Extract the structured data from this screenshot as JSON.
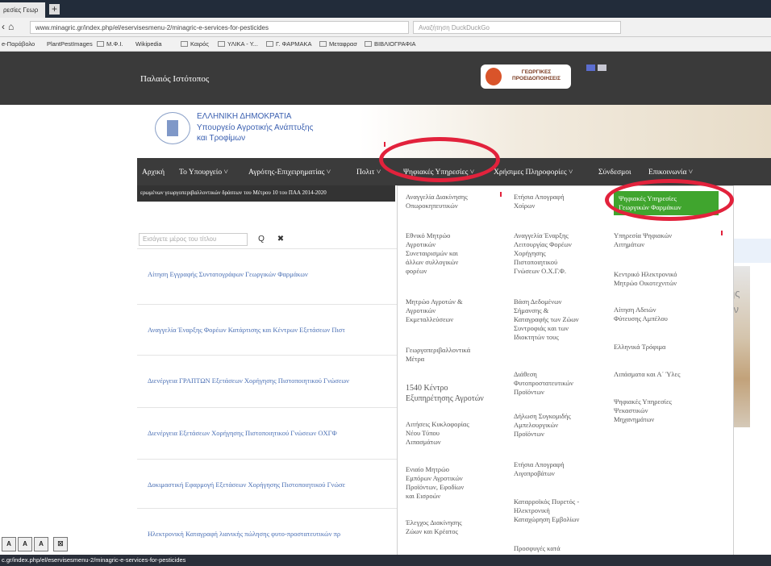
{
  "browser": {
    "tab_title": "ρεσίες Γεωρ",
    "new_tab": "+",
    "url": "www.minagric.gr/index.php/el/eservisesmenu-2/minagric-e-services-for-pesticides",
    "search_placeholder": "Αναζήτηση DuckDuckGo",
    "bookmarks": [
      {
        "label": "e-Παράβολο"
      },
      {
        "label": "PlantPestImages"
      },
      {
        "label": "M.Φ.Ι."
      },
      {
        "label": "Wikipedia"
      },
      {
        "label": "Καιρός"
      },
      {
        "label": "ΥΛΙΚΑ - Υ..."
      },
      {
        "label": "Γ. ΦΑΡΜΑΚΑ"
      },
      {
        "label": "Μεταφρασ"
      },
      {
        "label": "ΒΙΒΛΙΟΓΡΑΦΙΑ"
      }
    ]
  },
  "header": {
    "old_site": "Παλαιός Ιστότοπος",
    "logo_text": "ΓΕΩΡΓΙΚΕΣ ΠΡΟΕΙΔΟΠΟΙΗΣΕΙΣ",
    "gov_line1": "ΕΛΛΗΝΙΚΗ ΔΗΜΟΚΡΑΤΙΑ",
    "gov_line2": "Υπουργείο Αγροτικής Ανάπτυξης",
    "gov_line3": "και Τροφίμων"
  },
  "nav": {
    "home": "Αρχική",
    "ministry": "Το Υπουργείο ˅",
    "farmer": "Αγρότης-Επιχειρηματίας ˅",
    "policy": "Πολιτ ˅",
    "digital": "Ψηφιακές Υπηρεσίες ˅",
    "useful": "Χρήσιμες Πληροφορίες ˅",
    "links": "Σύνδεσμοι",
    "contact": "Επικοινωνία ˅",
    "ticker": "ερωμένων γεωργοπεριβαλλοντικών δράσεων του Μέτρου 10 του ΠΑΑ 2014-2020"
  },
  "search": {
    "placeholder": "Εισάγετε μέρος του τίτλου",
    "search_glyph": "Q",
    "clear_glyph": "✖"
  },
  "list": [
    "Αίτηση Εγγραφής Συντατογράφων Γεωργικών Φαρμάκων",
    "Αναγγελία Έναρξης Φορέων Κατάρτισης και Κέντρων Εξετάσεων Πιστ",
    "Διενέργεια ΓΡΑΠΤΩΝ Εξετάσεων Χορήγησης Πιστοποιητικού Γνώσεων",
    "Διενέργεια Εξετάσεων Χορήγησης Πιστοποιητικού Γνώσεων ΟΧΓΦ",
    "Δοκιμαστική Εφαρμογή Εξετάσεων Χορήγησης Πιστοποιητικού Γνώσε",
    "Ηλεκτρονική Καταγραφή λιανικής πώλησης φυτο-προστατευτικών πρ"
  ],
  "side": {
    "text1": "σης",
    "text2": "ρων"
  },
  "dropdown": {
    "col1": [
      "Αναγγελία Διακίνησης\nΟπωροκηπευτικών",
      "Εθνικό Μητρώο\nΑγροτικών\nΣυνεταιρισμών και\nάλλων συλλογικών\nφορέων",
      "Μητρώο Αγροτών &\nΑγροτικών\nΕκμεταλλεύσεων",
      "Γεωργοπεριβαλλοντικά\nΜέτρα",
      "1540 Κέντρο\nΕξυπηρέτησης Αγροτών",
      "Αιτήσεις Κυκλοφορίας\nΝέου Τύπου\nΛιπασμάτων",
      "Ενιαίο Μητρώο\nΕμπόρων Αγροτικών\nΠροϊόντων, Εφοδίων\nκαι Εισροών",
      "Έλεγχος Διακίνησης\nΖώων και Κρέατος"
    ],
    "col2": [
      "Ετήσια Απογραφή\nΧοίρων",
      "Αναγγελία Έναρξης\nΛειτουργίας Φορέων\nΧορήγησης\nΠιστοποιητικού\nΓνώσεων Ο.Χ.Γ.Φ.",
      "Βάση Δεδομένων\nΣήμανσης &\nΚαταγραφής των Ζώων\nΣυντροφιάς και των\nΙδιοκτητών τους",
      "Διάθεση\nΦυτοπροστατευτικών\nΠροϊόντων",
      "Δήλωση Συγκομιδής\nΑμπελουργικών\nΠροϊόντων",
      "Ετήσια Απογραφή\nΑιγοπροβάτων",
      "Καταρροϊκός Πυρετός -\nΗλεκτρονική\nΚαταχώρηση Εμβολίων",
      "Προσφυγές κατά\nΔιο..."
    ],
    "col3": [
      "Ψηφιακές Υπηρεσίες\nΓεωργικών Φαρμάκων",
      "Υπηρεσία Ψηφιακών\nΑιτημάτων",
      "Κεντρικό Ηλεκτρονικό\nΜητρώο Οικοτεχνιτών",
      "Αίτηση Αδειών\nΦύτευσης Αμπέλου",
      "Ελληνικά Τρόφιμα",
      "Λιπάσματα και Α΄ Ύλες",
      "Ψηφιακές Υπηρεσίες\nΨεκαστικών\nΜηχανημάτων"
    ]
  },
  "zoom": [
    "A",
    "A",
    "A",
    "☒"
  ],
  "status_url": "c.gr/index.php/el/eservisesmenu-2/minagric-e-services-for-pesticides",
  "colors": {
    "active_item": "#40a52e",
    "annotation": "#e2223c",
    "nav_bg": "#3b3b3b"
  }
}
